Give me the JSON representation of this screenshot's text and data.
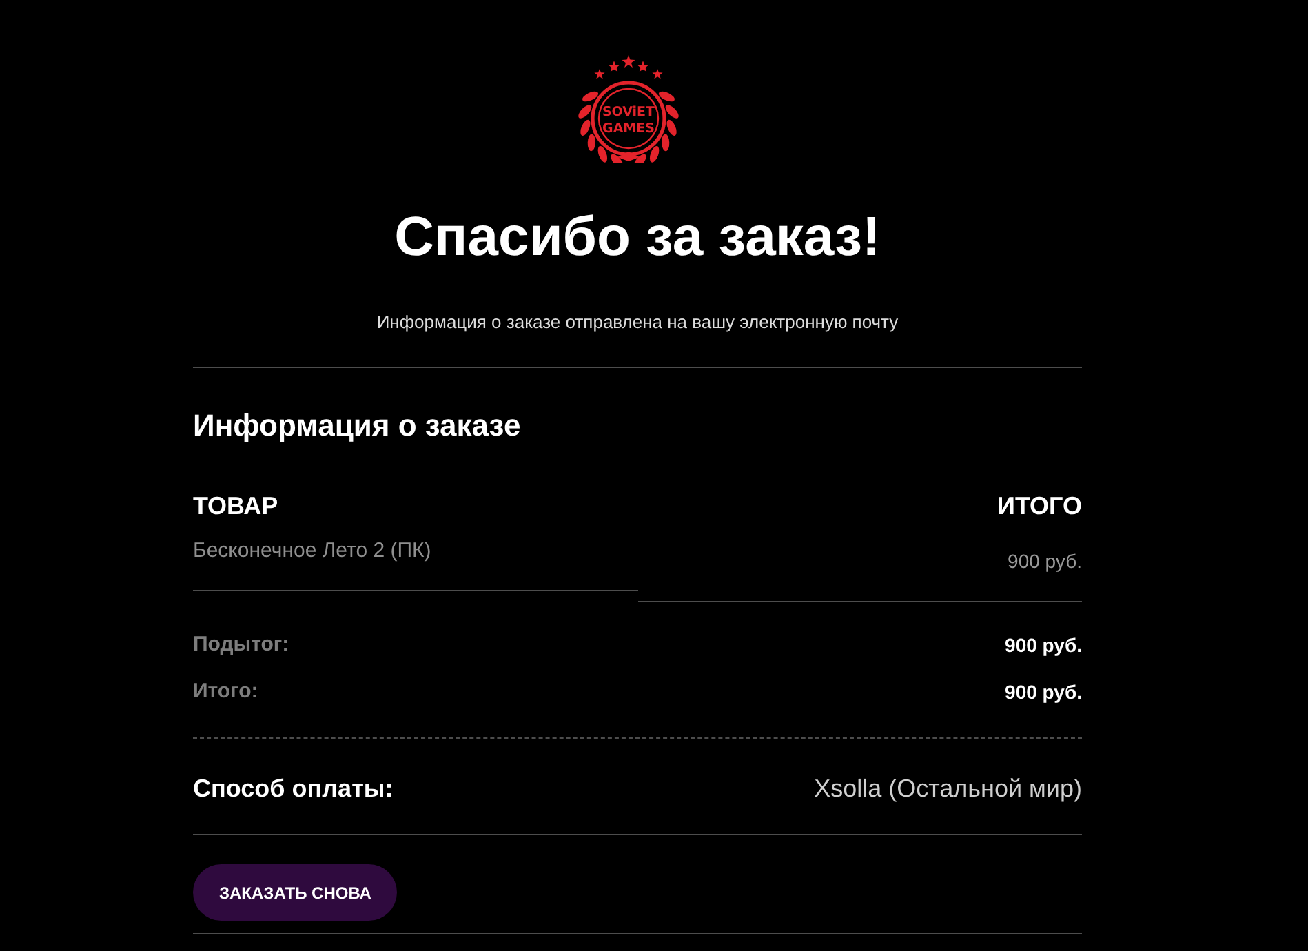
{
  "logo": {
    "top_line": "SOViET",
    "bottom_line": "GAMES"
  },
  "title": "Спасибо за заказ!",
  "subtitle": "Информация о заказе отправлена на вашу электронную почту",
  "order_details": {
    "heading": "Информация о заказе",
    "columns": [
      "ТОВАР",
      "ИТОГО"
    ],
    "items": [
      {
        "name": "Бесконечное Лето 2 (ПК)",
        "total": "900 руб."
      }
    ],
    "totals": [
      {
        "label": "Подытог:",
        "value": "900 руб."
      },
      {
        "label": "Итого:",
        "value": "900 руб."
      }
    ],
    "payment": {
      "label": "Способ оплаты:",
      "value": "Xsolla (Остальной мир)"
    }
  },
  "order_again_button": "ЗАКАЗАТЬ СНОВА"
}
